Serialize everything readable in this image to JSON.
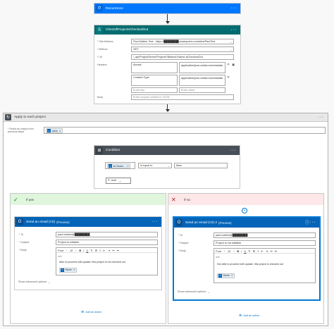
{
  "recurrence": {
    "title": "Recurrence",
    "icon": "clock-icon"
  },
  "http_action": {
    "title": "CheckIfProjectsCheckedOut",
    "fields": {
      "site_address": {
        "label": "* Site Address",
        "value": "Paul Mather Test - https://████████.sharepoint.com/sites/PaulTest"
      },
      "method": {
        "label": "* Method",
        "value": "GET"
      },
      "uri": {
        "label": "* Uri",
        "value": "/_api/ProjectServer/Projects?$select=Name,IsCheckedOut"
      },
      "headers": {
        "label": "Headers",
        "rows": [
          {
            "key": "Accept",
            "value": "application/json;odata=nometadata"
          },
          {
            "key": "Content-Type",
            "value": "application/json;odata=nometadata"
          }
        ],
        "key_placeholder": "Enter key",
        "value_placeholder": "Enter value"
      },
      "body": {
        "label": "Body",
        "placeholder": "Enter request content in JSON"
      }
    }
  },
  "apply_each": {
    "title": "Apply to each project",
    "select_label": "* Select an output from previous steps",
    "token": "value"
  },
  "condition": {
    "title": "Condition",
    "left_token": "IsChecke...",
    "operator": "is equal to",
    "right_value": "false",
    "add_label": "Add"
  },
  "if_yes": {
    "label": "If yes",
    "email": {
      "title": "Send an email (V2)",
      "preview": "(Preview)",
      "to_label": "* To",
      "to_value": "paul.mather@████████",
      "subject_label": "* Subject",
      "subject_value": "Project is editable",
      "body_label": "* Body",
      "font_label": "Font",
      "font_size": "12",
      "body_text": "Able to proceed with update, this project is not checked out",
      "name_token": "Name",
      "advanced": "Show advanced options"
    },
    "add_action": "Add an action"
  },
  "if_no": {
    "label": "If no",
    "email": {
      "title": "Send an email (V2) 2",
      "preview": "(Preview)",
      "to_label": "* To",
      "to_value": "paul.mather@████████",
      "subject_label": "* Subject",
      "subject_value": "Project is not editable",
      "body_label": "* Body",
      "font_label": "Font",
      "font_size": "12",
      "body_text": "Not able to proceed with update, this project is checked out",
      "name_token": "Name",
      "advanced": "Show advanced options"
    },
    "add_action": "Add an action"
  },
  "colors": {
    "recurrence": "#0077ff",
    "sharepoint": "#036c70",
    "control": "#484f58",
    "outlook": "#0364b8",
    "yes": "#dff6dd",
    "no": "#fde7e9"
  }
}
